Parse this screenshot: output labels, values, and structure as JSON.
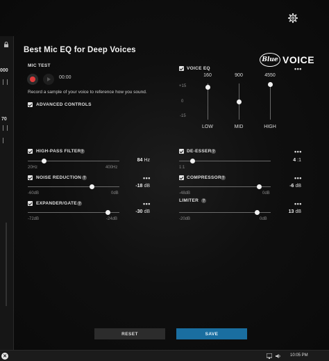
{
  "app": {
    "title": "Best Mic EQ for Deep Voices",
    "brand_badge": "Blue",
    "brand_text": "VOICE"
  },
  "left_strip": {
    "value_top": "000",
    "value_mid": "70"
  },
  "mic_test": {
    "label": "MIC TEST",
    "time": "00:00",
    "description": "Record a sample of your voice to reference how you sound.",
    "advanced_label": "ADVANCED CONTROLS"
  },
  "voice_eq": {
    "label": "VOICE EQ",
    "more": "•••",
    "scale": [
      "+15",
      "0",
      "-15"
    ],
    "bands": [
      {
        "freq": "160",
        "name": "LOW",
        "gain": 12
      },
      {
        "freq": "900",
        "name": "MID",
        "gain": 0
      },
      {
        "freq": "4550",
        "name": "HIGH",
        "gain": 14
      }
    ]
  },
  "controls_left": [
    {
      "label": "HIGH-PASS FILTER",
      "help": "?",
      "value": "84",
      "unit": "Hz",
      "min": "20Hz",
      "max": "400Hz",
      "fraction": 0.18
    },
    {
      "label": "NOISE REDUCTION",
      "help": "?",
      "value": "-18",
      "unit": "dB",
      "min": "-60dB",
      "max": "0dB",
      "fraction": 0.7,
      "more": "•••"
    },
    {
      "label": "EXPANDER/GATE",
      "help": "?",
      "value": "-30",
      "unit": "dB",
      "min": "-72dB",
      "max": "-24dB",
      "fraction": 0.875,
      "more": "•••"
    }
  ],
  "controls_right": [
    {
      "label": "DE-ESSER",
      "help": "?",
      "value": "4",
      "unit": ":1",
      "min": "1:1",
      "max": "",
      "fraction": 0.15,
      "more": "•••",
      "checkbox": true
    },
    {
      "label": "COMPRESSOR",
      "help": "?",
      "value": "-6",
      "unit": "dB",
      "min": "-48dB",
      "max": "0dB",
      "fraction": 0.875,
      "more": "•••",
      "checkbox": true
    },
    {
      "label": "LIMITER",
      "help": "?",
      "value": "13",
      "unit": "dB",
      "min": "-20dB",
      "max": "0dB",
      "fraction": 0.85,
      "more": "•••",
      "checkbox": false
    }
  ],
  "buttons": {
    "reset": "RESET",
    "save": "SAVE"
  },
  "taskbar": {
    "time": "10:05 PM"
  },
  "colors": {
    "accent": "#1a6ea0",
    "record": "#e03c3c"
  }
}
